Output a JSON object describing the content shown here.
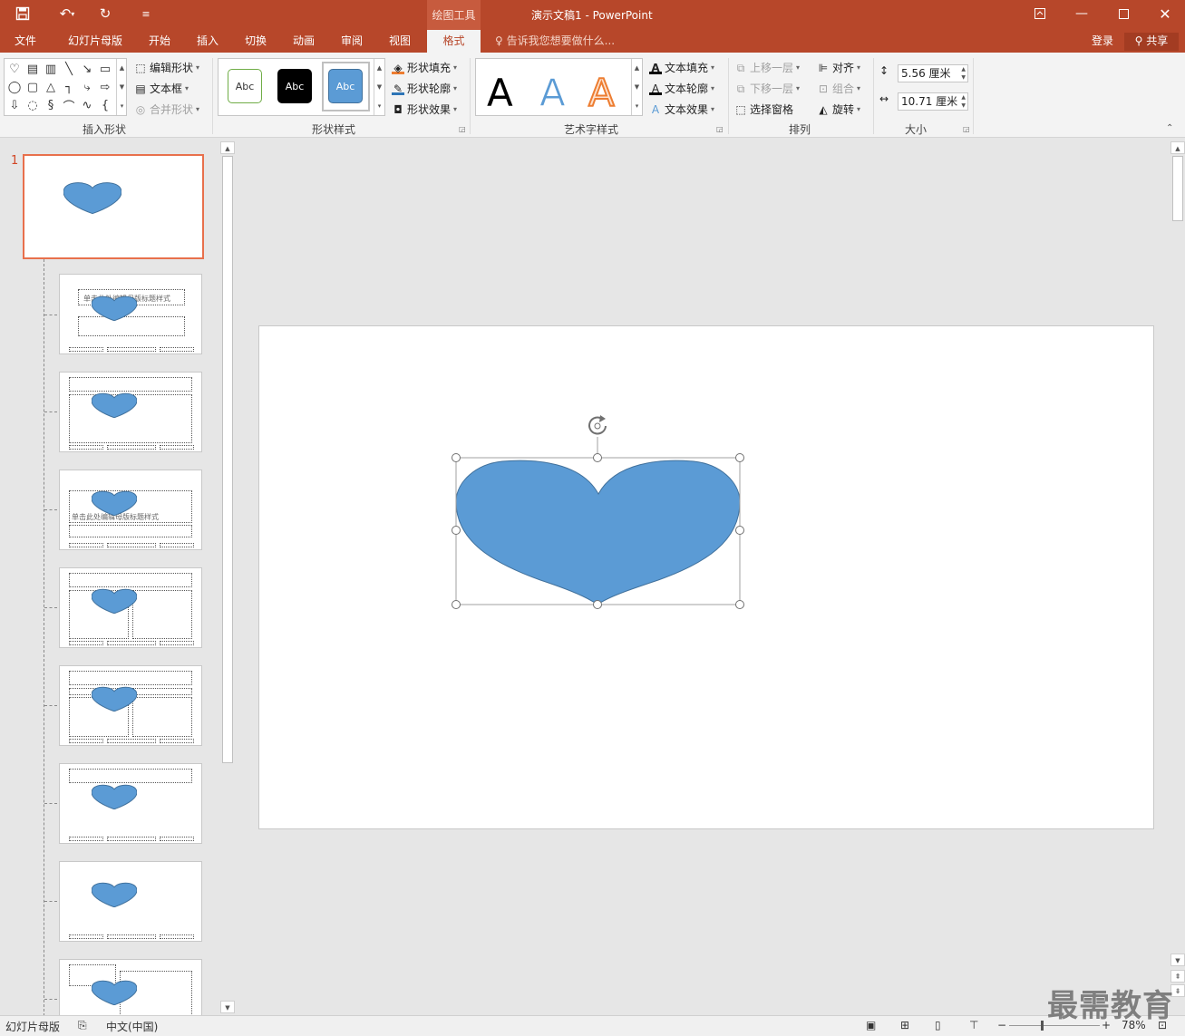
{
  "window": {
    "title": "演示文稿1 - PowerPoint",
    "context_tab": "绘图工具"
  },
  "menu": {
    "tabs": [
      "文件",
      "幻灯片母版",
      "开始",
      "插入",
      "切换",
      "动画",
      "审阅",
      "视图",
      "格式"
    ],
    "active_tab": "格式",
    "tell_me": "告诉我您想要做什么...",
    "login": "登录",
    "share": "共享"
  },
  "ribbon": {
    "insert_shapes": {
      "label": "插入形状",
      "edit_shape": "编辑形状",
      "text_box": "文本框",
      "merge_shapes": "合并形状"
    },
    "shape_styles": {
      "label": "形状样式",
      "swatches": [
        "Abc",
        "Abc",
        "Abc"
      ],
      "fill": "形状填充",
      "outline": "形状轮廓",
      "effects": "形状效果"
    },
    "wordart": {
      "label": "艺术字样式",
      "letters": [
        "A",
        "A",
        "A"
      ],
      "text_fill": "文本填充",
      "text_outline": "文本轮廓",
      "text_effects": "文本效果"
    },
    "arrange": {
      "label": "排列",
      "bring_forward": "上移一层",
      "send_backward": "下移一层",
      "selection_pane": "选择窗格",
      "align": "对齐",
      "group": "组合",
      "rotate": "旋转"
    },
    "size": {
      "label": "大小",
      "height": "5.56 厘米",
      "width": "10.71 厘米"
    }
  },
  "slides": {
    "first_number": "1",
    "layout_titles": [
      "单击此处编辑母版标题样式",
      "单击此处编辑母版标题样式"
    ]
  },
  "status": {
    "view": "幻灯片母版",
    "language": "中文(中国)",
    "zoom": "78%"
  },
  "watermark": "最需教育",
  "colors": {
    "brand": "#b7472a",
    "heart_fill": "#5b9bd5",
    "heart_stroke": "#41719c",
    "selection": "#e8704c"
  }
}
